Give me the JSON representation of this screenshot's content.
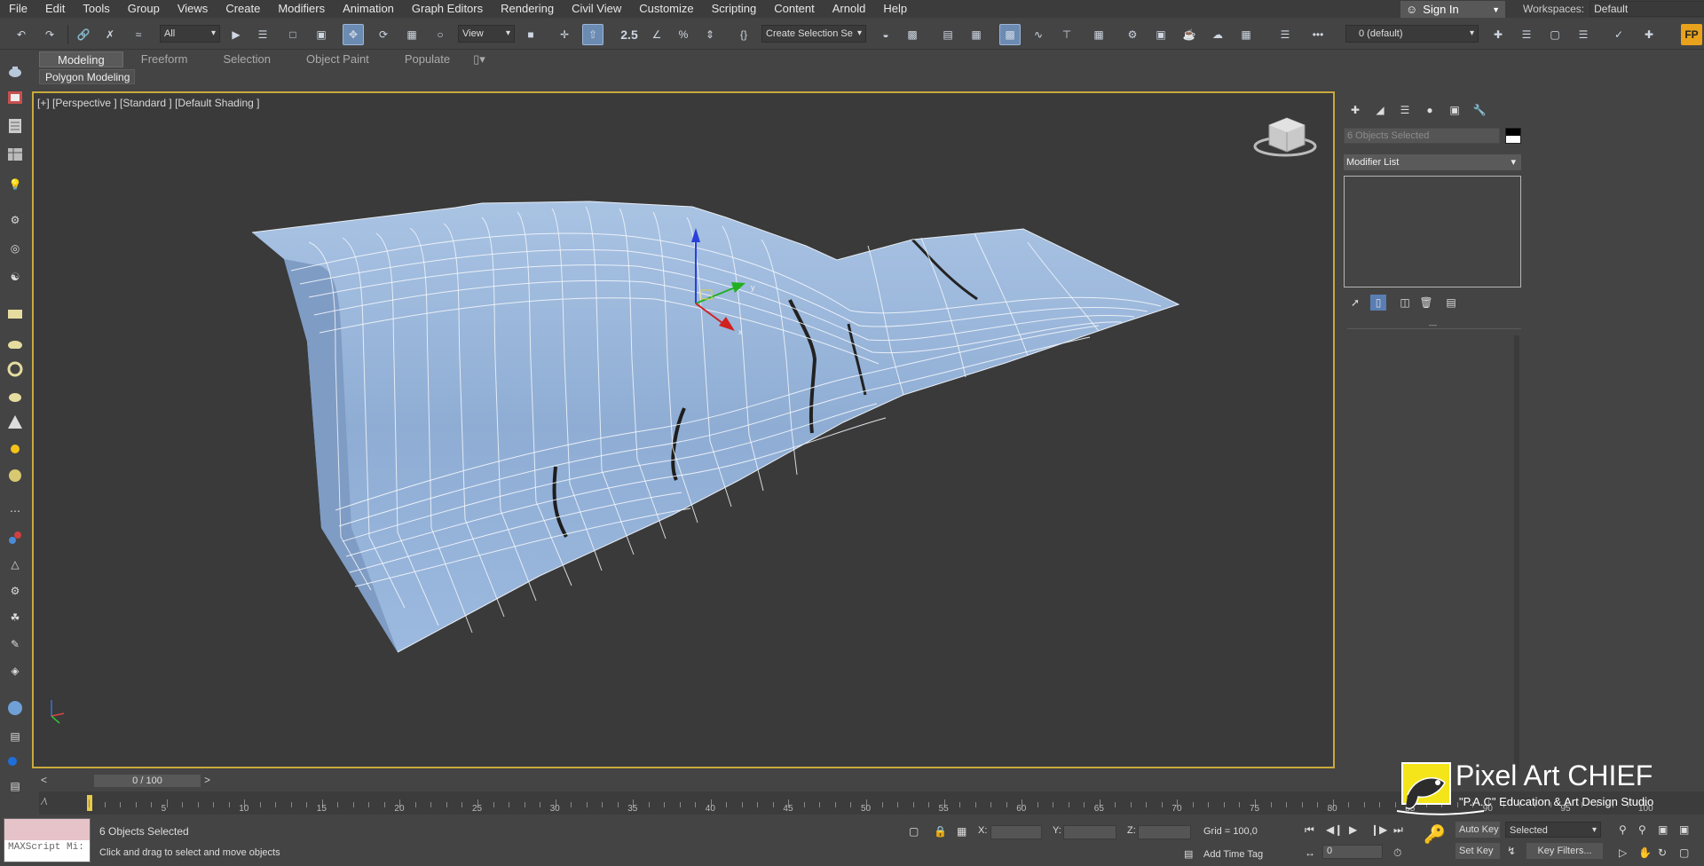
{
  "menu": [
    "File",
    "Edit",
    "Tools",
    "Group",
    "Views",
    "Create",
    "Modifiers",
    "Animation",
    "Graph Editors",
    "Rendering",
    "Civil View",
    "Customize",
    "Scripting",
    "Content",
    "Arnold",
    "Help"
  ],
  "account": {
    "signin": "Sign In"
  },
  "workspace": {
    "label": "Workspaces:",
    "value": "Default"
  },
  "toolbar": {
    "filter": "All",
    "ref_coord": "View",
    "snap_num": "2.5",
    "named_selection": "Create Selection Se",
    "layer": "0 (default)"
  },
  "ribbon": {
    "tabs": [
      "Modeling",
      "Freeform",
      "Selection",
      "Object Paint",
      "Populate"
    ],
    "active": "Modeling",
    "panel": "Polygon Modeling"
  },
  "viewport": {
    "label": "[+] [Perspective ] [Standard ] [Default Shading ]"
  },
  "command_panel": {
    "object_name": "6 Objects Selected",
    "modifier_list": "Modifier List"
  },
  "time_slider": {
    "frame": "0 / 100"
  },
  "timeline": {
    "ticks": [
      0,
      5,
      10,
      15,
      20,
      25,
      30,
      35,
      40,
      45,
      50,
      55,
      60,
      65,
      70,
      75,
      80,
      85,
      90,
      95,
      100
    ]
  },
  "status": {
    "maxscript": "MAXScript Mi:",
    "selection": "6 Objects Selected",
    "prompt": "Click and drag to select and move objects",
    "x_label": "X:",
    "y_label": "Y:",
    "z_label": "Z:",
    "grid": "Grid = 100,0",
    "add_time_tag": "Add Time Tag",
    "auto_key": "Auto Key",
    "set_key": "Set Key",
    "key_mode": "Selected",
    "key_filters": "Key Filters...",
    "frame_field": "0"
  },
  "watermark": {
    "title": "Pixel Art CHIEF",
    "subtitle": "\"P.A.C\" Education & Art Design Studio"
  },
  "colors": {
    "accent": "#c8a93d",
    "mesh": "#9ab6db",
    "viewport_bg": "#3a3a3a",
    "active_tool": "#6c8bb3"
  }
}
